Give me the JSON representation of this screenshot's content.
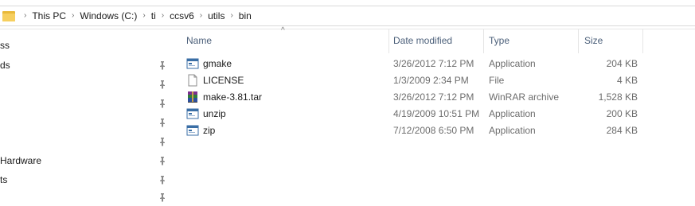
{
  "breadcrumb": [
    "This PC",
    "Windows (C:)",
    "ti",
    "ccsv6",
    "utils",
    "bin"
  ],
  "nav_items": [
    {
      "label": "ss",
      "pinned": false
    },
    {
      "label": "ds",
      "pinned": true
    },
    {
      "label": "",
      "pinned": true
    },
    {
      "label": "",
      "pinned": true
    },
    {
      "label": "",
      "pinned": true
    },
    {
      "label": "",
      "pinned": true
    },
    {
      "label": "Hardware",
      "pinned": true
    },
    {
      "label": "ts",
      "pinned": true
    },
    {
      "label": "",
      "pinned": true
    }
  ],
  "columns": {
    "name": "Name",
    "date_modified": "Date modified",
    "type": "Type",
    "size": "Size",
    "sort_indicator": "^"
  },
  "files": [
    {
      "name": "gmake",
      "date_modified": "3/26/2012 7:12 PM",
      "type": "Application",
      "size": "204 KB",
      "icon": "application-icon"
    },
    {
      "name": "LICENSE",
      "date_modified": "1/3/2009 2:34 PM",
      "type": "File",
      "size": "4 KB",
      "icon": "file-icon"
    },
    {
      "name": "make-3.81.tar",
      "date_modified": "3/26/2012 7:12 PM",
      "type": "WinRAR archive",
      "size": "1,528 KB",
      "icon": "winrar-archive-icon"
    },
    {
      "name": "unzip",
      "date_modified": "4/19/2009 10:51 PM",
      "type": "Application",
      "size": "200 KB",
      "icon": "application-icon"
    },
    {
      "name": "zip",
      "date_modified": "7/12/2008 6:50 PM",
      "type": "Application",
      "size": "284 KB",
      "icon": "application-icon"
    }
  ]
}
